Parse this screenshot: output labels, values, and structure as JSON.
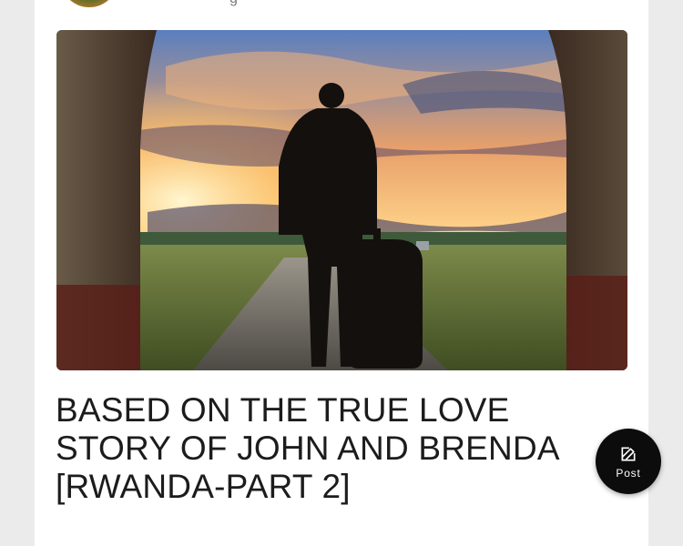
{
  "post": {
    "author_fragment": "g",
    "image_alt": "Man with a suitcase standing in an archway at sunset",
    "title": "BASED ON THE TRUE LOVE STORY OF JOHN AND BRENDA [RWANDA-PART 2]"
  },
  "fab": {
    "label": "Post",
    "icon": "edit-icon"
  },
  "colors": {
    "page_background": "#ebebeb",
    "card_background": "#ffffff",
    "fab_background": "#0c0c0c",
    "title_text": "#1c1c1c"
  }
}
